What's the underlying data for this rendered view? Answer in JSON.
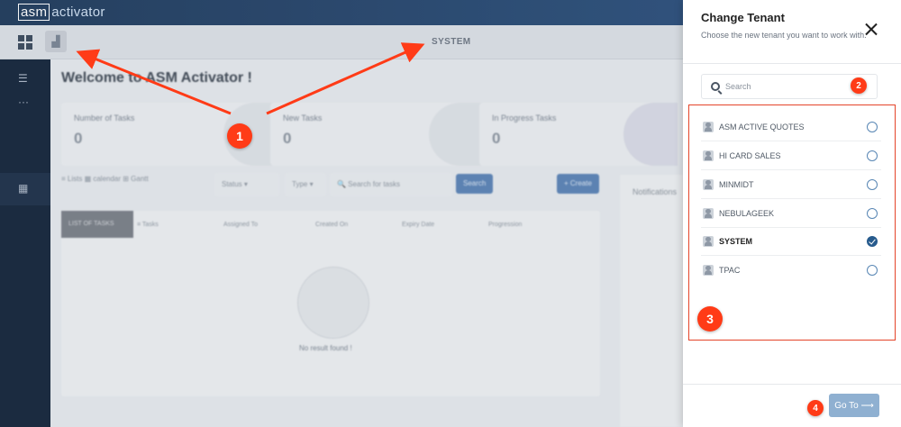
{
  "app": {
    "brand_part1": "asm",
    "brand_part2": "activator"
  },
  "subbar": {
    "tenant_label": "SYSTEM"
  },
  "main": {
    "welcome": "Welcome to ASM Activator !",
    "cards": [
      {
        "label": "Number of Tasks",
        "value": "0"
      },
      {
        "label": "New Tasks",
        "value": "0"
      },
      {
        "label": "In Progress Tasks",
        "value": "0"
      }
    ],
    "toolbar": {
      "views": "≡ Lists   ▦ calendar   ⊞ Gantt",
      "status": "Status ▾",
      "type": "Type ▾",
      "search_placeholder": "🔍  Search for tasks",
      "search_btn": "Search",
      "create_btn": "+ Create"
    },
    "table": {
      "tab_active": "LIST OF TASKS",
      "tab_other": "≡ Tasks",
      "headers": [
        "Assigned To",
        "Created On",
        "Expiry Date",
        "Progression"
      ],
      "empty": "No result found !"
    },
    "notifications": "Notifications"
  },
  "panel": {
    "title": "Change Tenant",
    "description": "Choose the new tenant you want to work with.",
    "search_placeholder": "Search",
    "tenants": [
      {
        "name": "ASM ACTIVE QUOTES",
        "selected": false
      },
      {
        "name": "HI CARD SALES",
        "selected": false
      },
      {
        "name": "MINMIDT",
        "selected": false
      },
      {
        "name": "NEBULAGEEK",
        "selected": false
      },
      {
        "name": "SYSTEM",
        "selected": true
      },
      {
        "name": "TPAC",
        "selected": false
      }
    ],
    "goto_label": "Go To ⟶"
  },
  "annotations": [
    "1",
    "2",
    "3",
    "4"
  ],
  "colors": {
    "badge": "#ff3b17",
    "highlight_box": "#e4442a",
    "primary": "#275b8d",
    "goto": "#8fb0d1"
  }
}
